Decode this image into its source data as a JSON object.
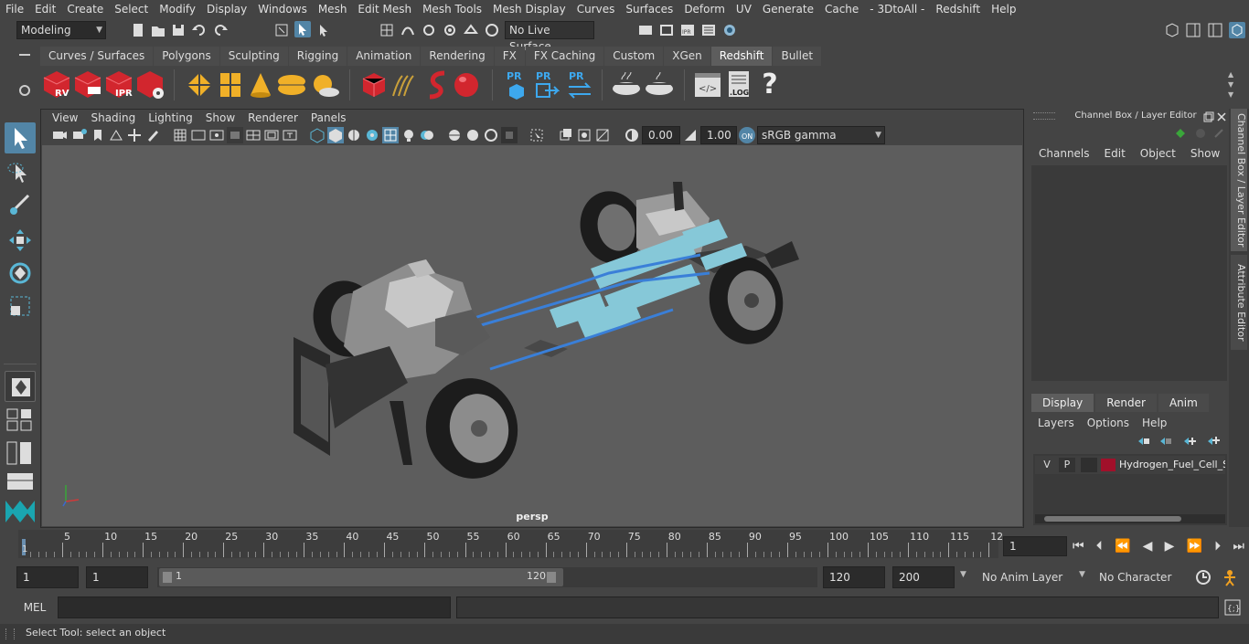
{
  "menubar": [
    "File",
    "Edit",
    "Create",
    "Select",
    "Modify",
    "Display",
    "Windows",
    "Mesh",
    "Edit Mesh",
    "Mesh Tools",
    "Mesh Display",
    "Curves",
    "Surfaces",
    "Deform",
    "UV",
    "Generate",
    "Cache",
    "- 3DtoAll -",
    "Redshift",
    "Help"
  ],
  "statusline": {
    "mode": "Modeling",
    "live_surface": "No Live Surface"
  },
  "shelf_tabs": [
    "Curves / Surfaces",
    "Polygons",
    "Sculpting",
    "Rigging",
    "Animation",
    "Rendering",
    "FX",
    "FX Caching",
    "Custom",
    "XGen",
    "Redshift",
    "Bullet"
  ],
  "shelf_active": "Redshift",
  "shelf_icons": {
    "rv": "RV",
    "ipr": "IPR",
    "pr": "PR",
    "log": ".LOG",
    "help": "?"
  },
  "viewport": {
    "menu": [
      "View",
      "Shading",
      "Lighting",
      "Show",
      "Renderer",
      "Panels"
    ],
    "exposure": "0.00",
    "gamma": "1.00",
    "colorspace": "sRGB gamma",
    "camera_label": "persp"
  },
  "channel_box": {
    "title": "Channel Box / Layer Editor",
    "menu": [
      "Channels",
      "Edit",
      "Object",
      "Show"
    ],
    "layer_tabs": [
      "Display",
      "Render",
      "Anim"
    ],
    "layer_menu": [
      "Layers",
      "Options",
      "Help"
    ],
    "layer": {
      "v": "V",
      "p": "P",
      "name": "Hydrogen_Fuel_Cell_S",
      "color": "#a0102a"
    }
  },
  "side_tabs": [
    "Channel Box / Layer Editor",
    "Attribute Editor"
  ],
  "timeline": {
    "ticks": [
      "5",
      "10",
      "15",
      "20",
      "25",
      "30",
      "35",
      "40",
      "45",
      "50",
      "55",
      "60",
      "65",
      "70",
      "75",
      "80",
      "85",
      "90",
      "95",
      "100",
      "105",
      "110",
      "115",
      "12"
    ],
    "start_marker": "1",
    "current_frame": "1"
  },
  "range": {
    "start": "1",
    "playback_start": "1",
    "slider_start": "1",
    "slider_end": "120",
    "playback_end": "120",
    "end": "200",
    "anim_layer": "No Anim Layer",
    "char_set": "No Character Set"
  },
  "cmdline": {
    "label": "MEL"
  },
  "helpline": "Select Tool: select an object",
  "colors": {
    "accent": "#5285a6",
    "bg": "#444444",
    "viewport": "#5d5d5d",
    "pipe": "#3a7fd8",
    "tank": "#86c8d8"
  }
}
